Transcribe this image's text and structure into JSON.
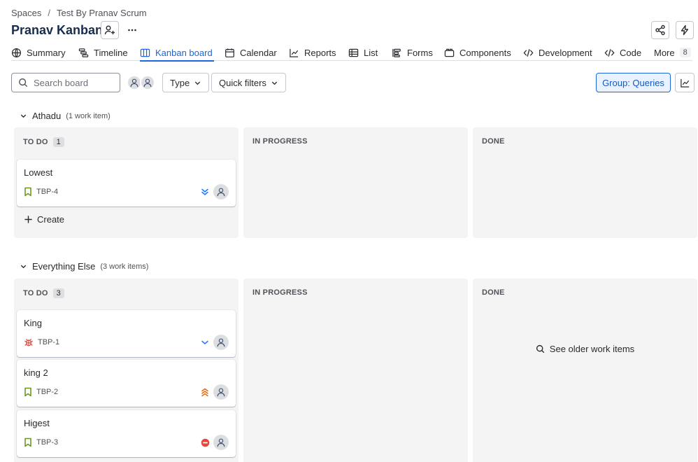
{
  "breadcrumb": {
    "items": [
      "Spaces",
      "Test By Pranav Scrum"
    ],
    "separator": "/"
  },
  "page": {
    "title": "Pranav Kanban"
  },
  "tabs": [
    {
      "label": "Summary",
      "icon": "globe-icon"
    },
    {
      "label": "Timeline",
      "icon": "timeline-icon"
    },
    {
      "label": "Kanban board",
      "icon": "board-icon",
      "active": true
    },
    {
      "label": "Calendar",
      "icon": "calendar-icon"
    },
    {
      "label": "Reports",
      "icon": "chart-line-icon"
    },
    {
      "label": "List",
      "icon": "list-icon"
    },
    {
      "label": "Forms",
      "icon": "form-icon"
    },
    {
      "label": "Components",
      "icon": "component-icon"
    },
    {
      "label": "Development",
      "icon": "code-branch-icon"
    },
    {
      "label": "Code",
      "icon": "code-icon"
    },
    {
      "label": "More",
      "count": "8"
    }
  ],
  "toolbar": {
    "search_placeholder": "Search board",
    "type_label": "Type",
    "quick_filters_label": "Quick filters",
    "group_label": "Group: Queries"
  },
  "colors": {
    "accent": "#1868db",
    "story_icon": "#6a9a23",
    "bug_icon": "#e2483d",
    "priority_low": "#1d7afc",
    "priority_high": "#e56910",
    "priority_blocker": "#e2483d"
  },
  "swimlanes": [
    {
      "name": "Athadu",
      "count_label": "(1 work item)",
      "columns": [
        {
          "title": "TO DO",
          "count": "1"
        },
        {
          "title": "IN PROGRESS"
        },
        {
          "title": "DONE"
        }
      ],
      "cards": [
        {
          "title": "Lowest",
          "key": "TBP-4",
          "type": "story",
          "priority": "lowest"
        }
      ],
      "create_label": "Create"
    },
    {
      "name": "Everything Else",
      "count_label": "(3 work items)",
      "columns": [
        {
          "title": "TO DO",
          "count": "3"
        },
        {
          "title": "IN PROGRESS"
        },
        {
          "title": "DONE"
        }
      ],
      "cards": [
        {
          "title": "King",
          "key": "TBP-1",
          "type": "bug",
          "priority": "low"
        },
        {
          "title": "king 2",
          "key": "TBP-2",
          "type": "story",
          "priority": "highest"
        },
        {
          "title": "Higest",
          "key": "TBP-3",
          "type": "story",
          "priority": "blocker"
        }
      ],
      "older_label": "See older work items"
    }
  ]
}
